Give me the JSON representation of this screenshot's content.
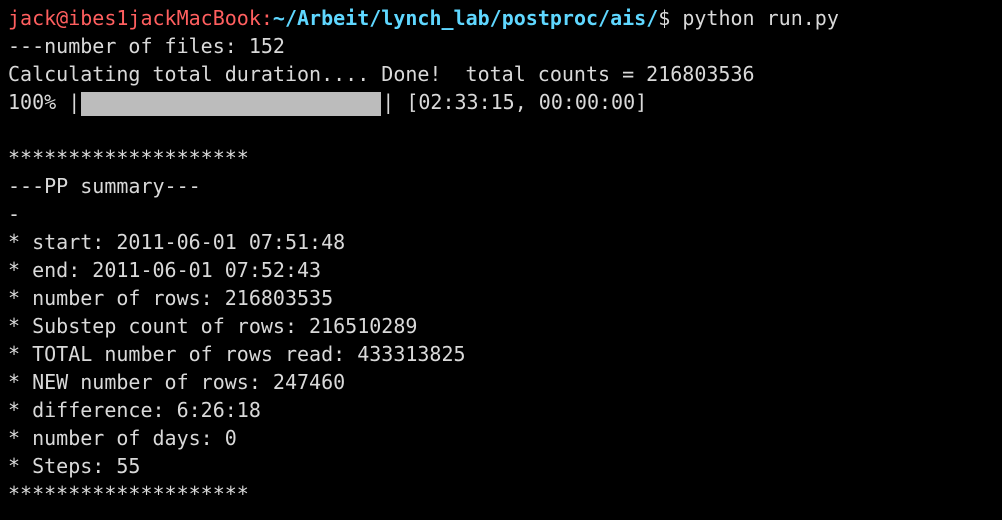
{
  "prompt": {
    "user_host": "jack@ibes1jackMacBook",
    "separator": ":",
    "path": "~/Arbeit/lynch_lab/postproc/ais/",
    "symbol": "$",
    "command": " python run.py"
  },
  "output": {
    "files_line": "---number of files: 152",
    "calc_line": "Calculating total duration.... Done!  total counts = 216803536",
    "progress": {
      "percent_label": "100%",
      "left_delim": " |",
      "right_delim": "|",
      "fraction": 1.0,
      "timing": " [02:33:15, 00:00:00]"
    },
    "blank": "",
    "stars_top": "********************",
    "summary_title": "---PP summary---",
    "dash": "-",
    "summary": [
      "* start: 2011-06-01 07:51:48",
      "* end: 2011-06-01 07:52:43",
      "* number of rows: 216803535",
      "* Substep count of rows: 216510289",
      "* TOTAL number of rows read: 433313825",
      "* NEW number of rows: 247460",
      "* difference: 6:26:18",
      "* number of days: 0",
      "* Steps: 55"
    ],
    "stars_bottom": "********************"
  },
  "colors": {
    "background": "#000000",
    "text": "#d9d9d9",
    "user_host": "#ff5f5f",
    "path": "#5fd7ff",
    "progress_fill": "#bcbcbc"
  }
}
